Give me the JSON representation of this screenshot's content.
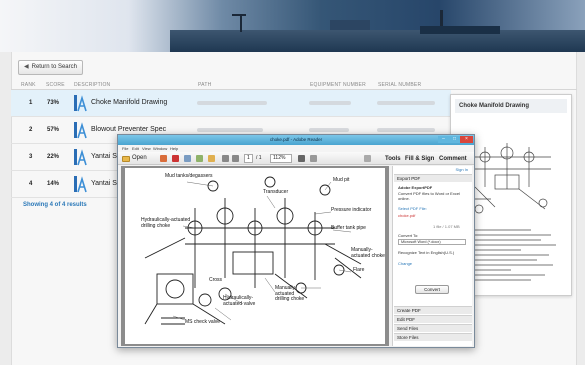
{
  "toolbar": {
    "return_label": "Return to Search"
  },
  "columns": [
    "RANK",
    "SCORE",
    "DESCRIPTION",
    "PATH",
    "EQUIPMENT NUMBER",
    "SERIAL NUMBER"
  ],
  "results": [
    {
      "rank": "1",
      "score": "73%",
      "description": "Choke Manifold Drawing",
      "selected": true
    },
    {
      "rank": "2",
      "score": "57%",
      "description": "Blowout Preventer Spec",
      "selected": false
    },
    {
      "rank": "3",
      "score": "22%",
      "description": "Yantai Sam",
      "selected": false
    },
    {
      "rank": "4",
      "score": "14%",
      "description": "Yantai Sam",
      "selected": false
    }
  ],
  "footer": {
    "showing": "Showing 4 of 4 results"
  },
  "preview": {
    "title": "Choke Manifold Drawing"
  },
  "reader": {
    "window_title": "choke.pdf - Adobe Reader",
    "menu": [
      "File",
      "Edit",
      "View",
      "Window",
      "Help"
    ],
    "open_label": "Open",
    "page_current": "1",
    "page_total": "/ 1",
    "zoom": "112%",
    "tools_label": "Tools",
    "fill_sign_label": "Fill & Sign",
    "comment_label": "Comment",
    "sign_in": "Sign In",
    "labels": {
      "mud_tanks": "Mud tanks/degassers",
      "transducer": "Transducer",
      "mud_pit": "Mud pit",
      "hydraulic_drilling": "Hydraulically-actuated\ndrilling choke",
      "pressure_indicator": "Pressure indicator",
      "buffer_tank": "Buffer tank pipe",
      "manually_choke": "Manually-\nactuated choke",
      "flare": "Flare",
      "cross": "Cross",
      "hydraulic_valve": "Hydraulically-\nactuated valve",
      "manually_drilling": "Manually-\nactuated\ndrilling choke",
      "ms_check": "MS check valve"
    },
    "side_panel": {
      "export_header": "Export PDF",
      "export_title": "Adobe ExportPDF",
      "export_desc": "Convert PDF files to Word or Excel online.",
      "select_file": "Select PDF File:",
      "file_name": "choke.pdf",
      "file_count": "1 file / 1.07 MB",
      "convert_to_label": "Convert To:",
      "convert_to_value": "Microsoft Word (*.docx)",
      "recognize_text": "Recognize Text in English(U.S.)",
      "change": "Change",
      "convert_button": "Convert",
      "sections": [
        "Create PDF",
        "Edit PDF",
        "Send Files",
        "Store Files"
      ]
    }
  }
}
